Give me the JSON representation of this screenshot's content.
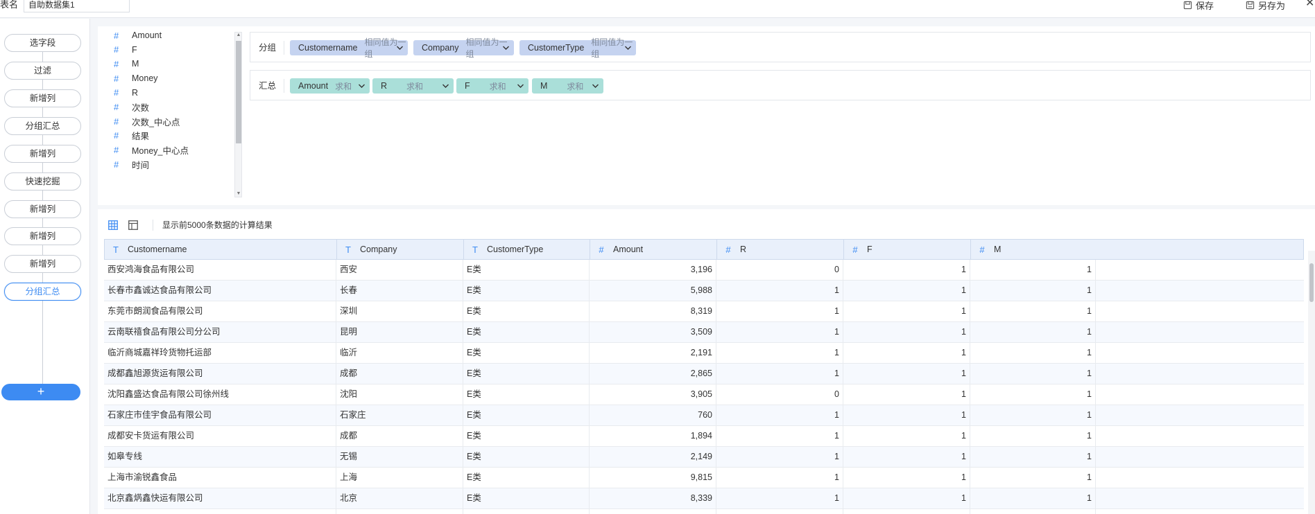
{
  "topbar": {
    "table_label": "表名",
    "table_name": "自助数据集1",
    "save_label": "保存",
    "save_as_label": "另存为",
    "close_glyph": "✕"
  },
  "sidebar": {
    "steps": [
      {
        "label": "选字段",
        "active": false
      },
      {
        "label": "过滤",
        "active": false
      },
      {
        "label": "新增列",
        "active": false
      },
      {
        "label": "分组汇总",
        "active": false
      },
      {
        "label": "新增列",
        "active": false
      },
      {
        "label": "快速挖掘",
        "active": false
      },
      {
        "label": "新增列",
        "active": false
      },
      {
        "label": "新增列",
        "active": false
      },
      {
        "label": "新增列",
        "active": false
      },
      {
        "label": "分组汇总",
        "active": true
      }
    ],
    "add_label": "+"
  },
  "fields": [
    {
      "icon": "#",
      "name": "Amount"
    },
    {
      "icon": "#",
      "name": "F"
    },
    {
      "icon": "#",
      "name": "M"
    },
    {
      "icon": "#",
      "name": "Money"
    },
    {
      "icon": "#",
      "name": "R"
    },
    {
      "icon": "#",
      "name": "次数"
    },
    {
      "icon": "#",
      "name": "次数_中心点"
    },
    {
      "icon": "#",
      "name": "结果"
    },
    {
      "icon": "#",
      "name": "Money_中心点"
    },
    {
      "icon": "#",
      "name": "时间"
    }
  ],
  "group_section": {
    "label": "分组",
    "chips": [
      {
        "name": "Customername",
        "mode": "相同值为一组"
      },
      {
        "name": "Company",
        "mode": "相同值为一组"
      },
      {
        "name": "CustomerType",
        "mode": "相同值为一组"
      }
    ]
  },
  "summary_section": {
    "label": "汇总",
    "chips": [
      {
        "name": "Amount",
        "mode": "求和"
      },
      {
        "name": "R",
        "mode": "求和"
      },
      {
        "name": "F",
        "mode": "求和"
      },
      {
        "name": "M",
        "mode": "求和"
      }
    ]
  },
  "data_toolbar": {
    "info_text": "显示前5000条数据的计算结果",
    "table_view_icon": "grid-table-icon",
    "detail_view_icon": "layout-icon"
  },
  "table": {
    "columns": [
      {
        "type": "T",
        "name": "Customername"
      },
      {
        "type": "T",
        "name": "Company"
      },
      {
        "type": "T",
        "name": "CustomerType"
      },
      {
        "type": "#",
        "name": "Amount"
      },
      {
        "type": "#",
        "name": "R"
      },
      {
        "type": "#",
        "name": "F"
      },
      {
        "type": "#",
        "name": "M"
      }
    ],
    "rows": [
      [
        "西安鸿海食品有限公司",
        "西安",
        "E类",
        "3,196",
        "0",
        "1",
        "1"
      ],
      [
        "长春市鑫诚达食品有限公司",
        "长春",
        "E类",
        "5,988",
        "1",
        "1",
        "1"
      ],
      [
        "东莞市朗润食品有限公司",
        "深圳",
        "E类",
        "8,319",
        "1",
        "1",
        "1"
      ],
      [
        "云南联禧食品有限公司分公司",
        "昆明",
        "E类",
        "3,509",
        "1",
        "1",
        "1"
      ],
      [
        "临沂商城嘉祥玲货物托运部",
        "临沂",
        "E类",
        "2,191",
        "1",
        "1",
        "1"
      ],
      [
        "成都鑫旭源货运有限公司",
        "成都",
        "E类",
        "2,865",
        "1",
        "1",
        "1"
      ],
      [
        "沈阳鑫盛达食品有限公司徐州线",
        "沈阳",
        "E类",
        "3,905",
        "0",
        "1",
        "1"
      ],
      [
        "石家庄市佳宇食品有限公司",
        "石家庄",
        "E类",
        "760",
        "1",
        "1",
        "1"
      ],
      [
        "成都安卡货运有限公司",
        "成都",
        "E类",
        "1,894",
        "1",
        "1",
        "1"
      ],
      [
        "如皋专线",
        "无锡",
        "E类",
        "2,149",
        "1",
        "1",
        "1"
      ],
      [
        "上海市渝锐鑫食品",
        "上海",
        "E类",
        "9,815",
        "1",
        "1",
        "1"
      ],
      [
        "北京鑫焫鑫快运有限公司",
        "北京",
        "E类",
        "8,339",
        "1",
        "1",
        "1"
      ],
      [
        "",
        "",
        "",
        "",
        "",
        "",
        ""
      ]
    ]
  }
}
